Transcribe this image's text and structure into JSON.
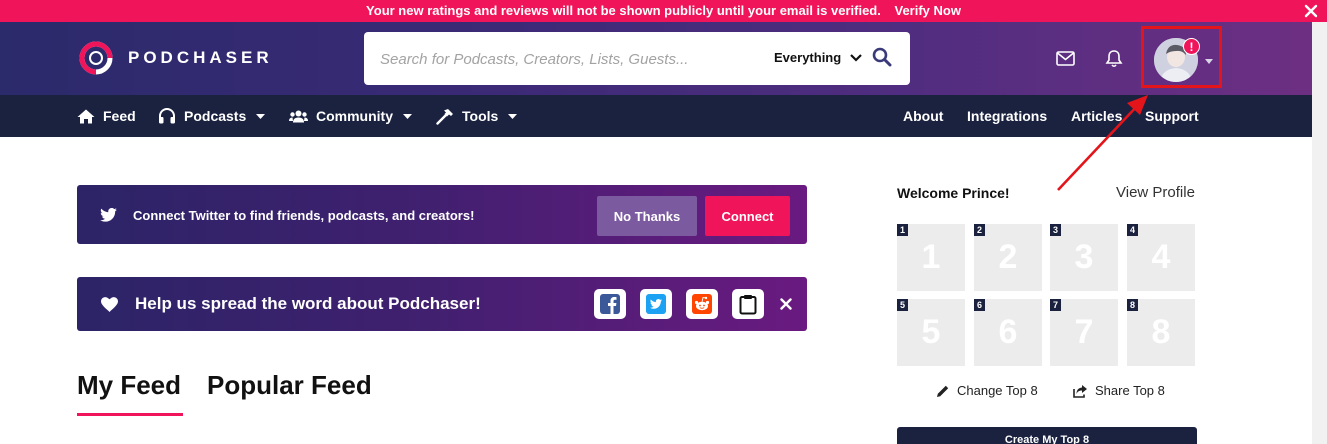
{
  "alert": {
    "message": "Your new ratings and reviews will not be shown publicly until your email is verified.",
    "action_label": "Verify Now"
  },
  "header": {
    "logo_text": "PODCHASER",
    "search": {
      "placeholder": "Search for Podcasts, Creators, Lists, Guests...",
      "value": "",
      "scope": "Everything"
    },
    "avatar_badge": "!"
  },
  "nav": {
    "left": [
      {
        "label": "Feed",
        "icon": "home-icon"
      },
      {
        "label": "Podcasts",
        "icon": "headphones-icon",
        "dropdown": true
      },
      {
        "label": "Community",
        "icon": "users-icon",
        "dropdown": true
      },
      {
        "label": "Tools",
        "icon": "hammer-icon",
        "dropdown": true
      }
    ],
    "right": [
      "About",
      "Integrations",
      "Articles",
      "Support"
    ]
  },
  "twitter_card": {
    "text": "Connect Twitter to find friends, podcasts, and creators!",
    "no_thanks_label": "No Thanks",
    "connect_label": "Connect"
  },
  "spread_card": {
    "text": "Help us spread the word about Podchaser!",
    "share_targets": [
      "facebook-icon",
      "twitter-icon",
      "reddit-icon",
      "clipboard-icon"
    ]
  },
  "feed_tabs": {
    "my_feed": "My Feed",
    "popular_feed": "Popular Feed",
    "active": "My Feed"
  },
  "sidebar": {
    "welcome": "Welcome Prince!",
    "view_profile": "View Profile",
    "top8_slots": [
      "1",
      "2",
      "3",
      "4",
      "5",
      "6",
      "7",
      "8"
    ],
    "change_top8": "Change Top 8",
    "share_top8": "Share Top 8",
    "create_top8": "Create My Top 8"
  },
  "colors": {
    "brand_pink": "#f0145a",
    "nav_dark": "#1b2240",
    "highlight_red": "#e4141b"
  }
}
